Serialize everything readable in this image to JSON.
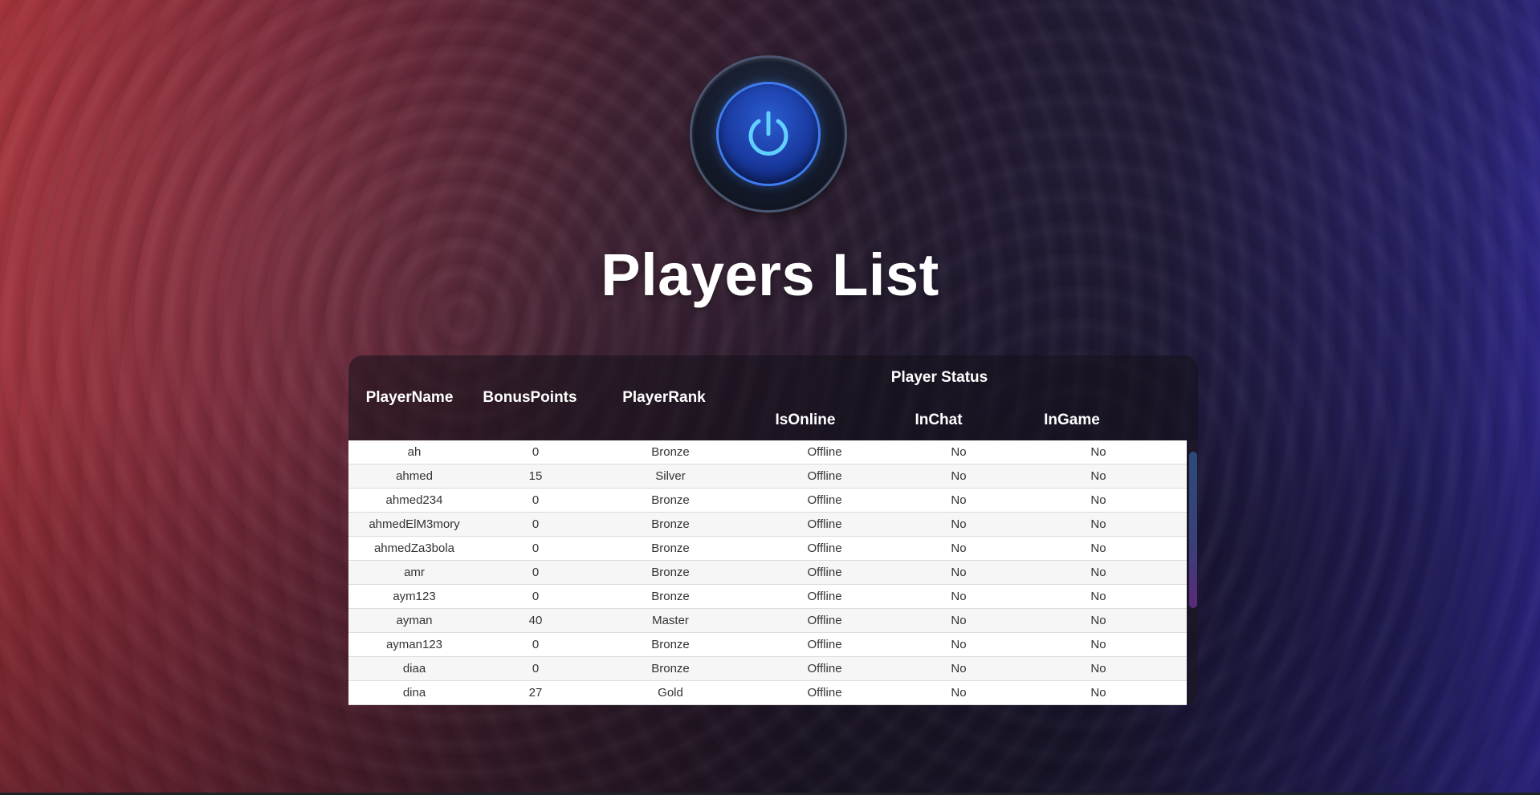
{
  "page": {
    "title": "Players List"
  },
  "icons": {
    "power": "power-icon"
  },
  "table": {
    "group_header": "Player Status",
    "headers": {
      "player_name": "PlayerName",
      "bonus_points": "BonusPoints",
      "player_rank": "PlayerRank",
      "is_online": "IsOnline",
      "in_chat": "InChat",
      "in_game": "InGame"
    },
    "rows": [
      {
        "name": "ah",
        "points": "0",
        "rank": "Bronze",
        "online": "Offline",
        "chat": "No",
        "game": "No"
      },
      {
        "name": "ahmed",
        "points": "15",
        "rank": "Silver",
        "online": "Offline",
        "chat": "No",
        "game": "No"
      },
      {
        "name": "ahmed234",
        "points": "0",
        "rank": "Bronze",
        "online": "Offline",
        "chat": "No",
        "game": "No"
      },
      {
        "name": "ahmedElM3mory",
        "points": "0",
        "rank": "Bronze",
        "online": "Offline",
        "chat": "No",
        "game": "No"
      },
      {
        "name": "ahmedZa3bola",
        "points": "0",
        "rank": "Bronze",
        "online": "Offline",
        "chat": "No",
        "game": "No"
      },
      {
        "name": "amr",
        "points": "0",
        "rank": "Bronze",
        "online": "Offline",
        "chat": "No",
        "game": "No"
      },
      {
        "name": "aym123",
        "points": "0",
        "rank": "Bronze",
        "online": "Offline",
        "chat": "No",
        "game": "No"
      },
      {
        "name": "ayman",
        "points": "40",
        "rank": "Master",
        "online": "Offline",
        "chat": "No",
        "game": "No"
      },
      {
        "name": "ayman123",
        "points": "0",
        "rank": "Bronze",
        "online": "Offline",
        "chat": "No",
        "game": "No"
      },
      {
        "name": "diaa",
        "points": "0",
        "rank": "Bronze",
        "online": "Offline",
        "chat": "No",
        "game": "No"
      },
      {
        "name": "dina",
        "points": "27",
        "rank": "Gold",
        "online": "Offline",
        "chat": "No",
        "game": "No"
      }
    ]
  },
  "colors": {
    "accent_blue": "#3e7cf0",
    "bg_left": "#a5323a",
    "bg_right": "#3a2fb0"
  }
}
